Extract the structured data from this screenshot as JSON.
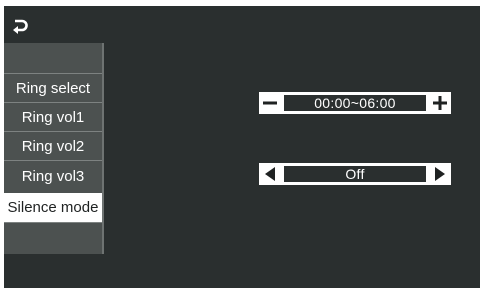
{
  "header": {
    "back_icon": "return-arrow-icon"
  },
  "sidebar": {
    "items": [
      {
        "label": "Ring select",
        "active": false
      },
      {
        "label": "Ring vol1",
        "active": false
      },
      {
        "label": "Ring vol2",
        "active": false
      },
      {
        "label": "Ring vol3",
        "active": false
      },
      {
        "label": "Silence mode",
        "active": true
      }
    ]
  },
  "settings": {
    "time_range": {
      "value": "00:00~06:00",
      "decrement_icon": "minus-icon",
      "increment_icon": "plus-icon"
    },
    "silence_toggle": {
      "value": "Off",
      "prev_icon": "triangle-left-icon",
      "next_icon": "triangle-right-icon"
    }
  },
  "colors": {
    "background": "#2a2f2f",
    "sidebar": "#4c5150",
    "active_item": "#ffffff",
    "text": "#ffffff"
  }
}
